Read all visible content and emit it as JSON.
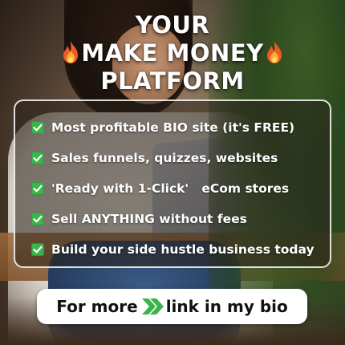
{
  "headline": {
    "line1": "YOUR",
    "line2": "MAKE MONEY",
    "line3": "PLATFORM",
    "decoration_icon": "fire-emoji-icon"
  },
  "features": {
    "check_icon": "green-check-icon",
    "check_color": "#3bb54a",
    "items": [
      {
        "label": "Most profitable BIO site (it's FREE)"
      },
      {
        "label": "Sales funnels, quizzes, websites"
      },
      {
        "label": "'Ready with 1-Click'   eCom stores"
      },
      {
        "label": "Sell ANYTHING without fees"
      },
      {
        "label": "Build your side hustle business today"
      }
    ]
  },
  "cta": {
    "before": "For more",
    "after": "link in my bio",
    "arrow_icon": "double-chevron-right-icon",
    "arrow_color": "#3bb54a"
  }
}
